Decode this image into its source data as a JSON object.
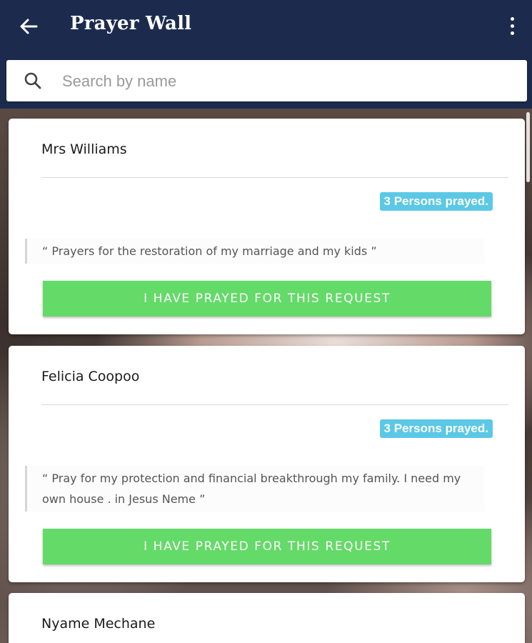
{
  "appbar": {
    "title": "Prayer Wall",
    "back_icon": "arrow-left-icon",
    "menu_icon": "more-vert-icon",
    "color": "#1c2b4d"
  },
  "search": {
    "placeholder": "Search by name",
    "value": "",
    "icon": "search-icon"
  },
  "colors": {
    "badge": "#5bc8e5",
    "pray_button": "#64da68"
  },
  "requests": [
    {
      "name": "Mrs Williams",
      "prayed_label": "3 Persons prayed.",
      "text": "“ Prayers for the restoration of my marriage and my kids ”",
      "button_label": "I HAVE PRAYED FOR THIS REQUEST"
    },
    {
      "name": "Felicia Coopoo",
      "prayed_label": "3 Persons prayed.",
      "text": "“ Pray for my protection and financial breakthrough my family. I need my own house . in Jesus Neme ”",
      "button_label": "I HAVE PRAYED FOR THIS REQUEST"
    },
    {
      "name": "Nyame Mechane"
    }
  ]
}
